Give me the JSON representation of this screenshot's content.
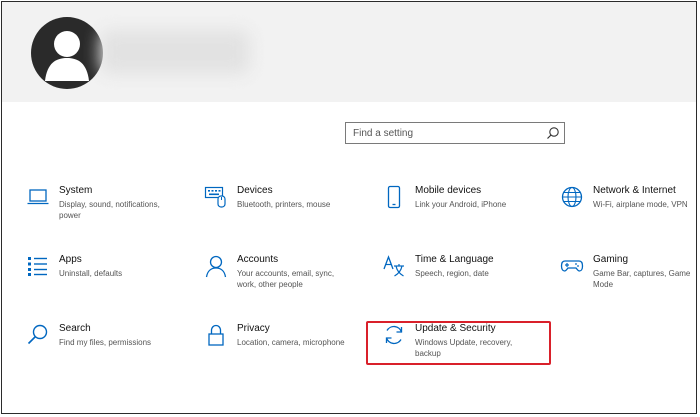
{
  "search": {
    "placeholder": "Find a setting"
  },
  "icons": {
    "accent": "#0067c0",
    "highlight": "#d9202a"
  },
  "tiles": [
    {
      "title": "System",
      "desc": "Display, sound, notifications, power",
      "icon": "laptop-icon"
    },
    {
      "title": "Devices",
      "desc": "Bluetooth, printers, mouse",
      "icon": "keyboard-icon"
    },
    {
      "title": "Mobile devices",
      "desc": "Link your Android, iPhone",
      "icon": "phone-icon"
    },
    {
      "title": "Network & Internet",
      "desc": "Wi-Fi, airplane mode, VPN",
      "icon": "globe-icon"
    },
    {
      "title": "Apps",
      "desc": "Uninstall, defaults",
      "icon": "list-icon"
    },
    {
      "title": "Accounts",
      "desc": "Your accounts, email, sync, work, other people",
      "icon": "person-icon"
    },
    {
      "title": "Time & Language",
      "desc": "Speech, region, date",
      "icon": "language-icon"
    },
    {
      "title": "Gaming",
      "desc": "Game Bar, captures, Game Mode",
      "icon": "gamepad-icon"
    },
    {
      "title": "Search",
      "desc": "Find my files, permissions",
      "icon": "magnifier-icon"
    },
    {
      "title": "Privacy",
      "desc": "Location, camera, microphone",
      "icon": "lock-icon"
    },
    {
      "title": "Update & Security",
      "desc": "Windows Update, recovery, backup",
      "icon": "sync-icon"
    }
  ]
}
